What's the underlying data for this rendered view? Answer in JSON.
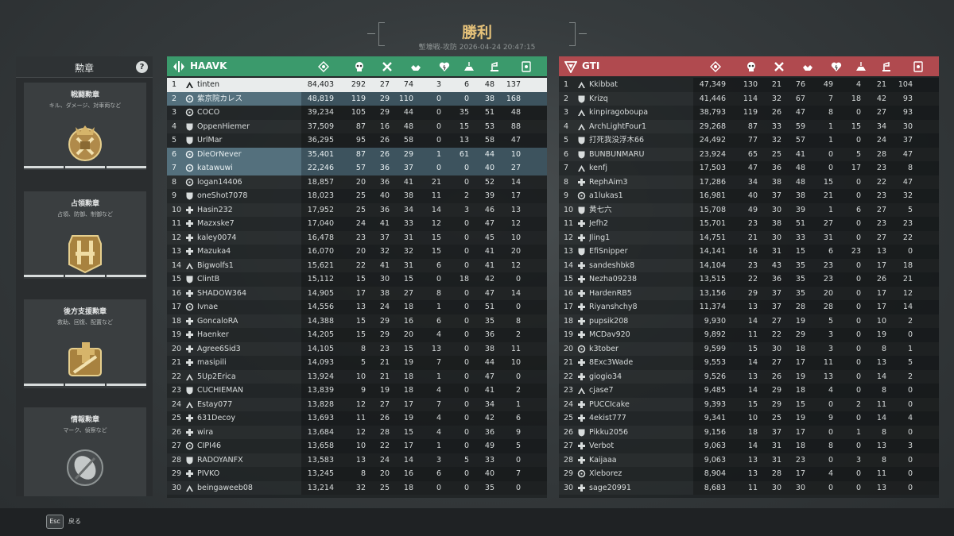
{
  "header": {
    "title": "勝利",
    "subtitle": "塹壕戦-攻防 2026-04-24 20:47:15"
  },
  "medals": {
    "title": "勲章",
    "help": "?",
    "cards": [
      {
        "name": "戦闘勲章",
        "desc": "キル、ダメージ、対車両など",
        "icon": "combat-medal"
      },
      {
        "name": "占領勲章",
        "desc": "占領、防御、制御など",
        "icon": "objective-medal"
      },
      {
        "name": "後方支援勲章",
        "desc": "救助、回復、配置など",
        "icon": "support-medal"
      },
      {
        "name": "情報勲章",
        "desc": "マーク、偵察など",
        "icon": "intel-medal"
      }
    ]
  },
  "footer": {
    "esc_key": "Esc",
    "back_label": "戻る"
  },
  "columns": [
    "score-icon",
    "kills-icon",
    "deaths-icon",
    "assists-icon",
    "revives-icon",
    "objective-icon",
    "support-icon",
    "intel-icon"
  ],
  "teams": [
    {
      "name": "HAAVK",
      "color": "#3b9a6c",
      "players": [
        {
          "rank": "1",
          "cls": "assault",
          "name": "tinten",
          "stats": [
            "84,403",
            "292",
            "27",
            "74",
            "3",
            "6",
            "48",
            "137"
          ],
          "highlight": "self"
        },
        {
          "rank": "2",
          "cls": "recon",
          "name": "紫京院カレス",
          "stats": [
            "48,819",
            "119",
            "29",
            "110",
            "0",
            "0",
            "38",
            "168"
          ],
          "highlight": "party"
        },
        {
          "rank": "3",
          "cls": "recon",
          "name": "COCO",
          "stats": [
            "39,234",
            "105",
            "29",
            "44",
            "0",
            "35",
            "51",
            "48"
          ]
        },
        {
          "rank": "4",
          "cls": "engineer",
          "name": "OppenHiemer",
          "stats": [
            "37,509",
            "87",
            "16",
            "48",
            "0",
            "15",
            "53",
            "88"
          ]
        },
        {
          "rank": "5",
          "cls": "engineer",
          "name": "UrlMar",
          "stats": [
            "36,295",
            "95",
            "26",
            "58",
            "0",
            "13",
            "58",
            "47"
          ]
        },
        {
          "rank": "6",
          "cls": "recon",
          "name": "DieOrNever",
          "stats": [
            "35,401",
            "87",
            "26",
            "29",
            "1",
            "61",
            "44",
            "10"
          ],
          "highlight": "party"
        },
        {
          "rank": "7",
          "cls": "recon",
          "name": "katawuwi",
          "stats": [
            "22,246",
            "57",
            "36",
            "37",
            "0",
            "0",
            "40",
            "27"
          ],
          "highlight": "party"
        },
        {
          "rank": "8",
          "cls": "recon",
          "name": "logan14406",
          "stats": [
            "18,857",
            "20",
            "36",
            "41",
            "21",
            "0",
            "52",
            "14"
          ]
        },
        {
          "rank": "9",
          "cls": "engineer",
          "name": "oneShot7078",
          "stats": [
            "18,023",
            "25",
            "40",
            "38",
            "11",
            "2",
            "39",
            "17"
          ]
        },
        {
          "rank": "10",
          "cls": "support",
          "name": "Hasin232",
          "stats": [
            "17,952",
            "25",
            "36",
            "34",
            "14",
            "3",
            "46",
            "13"
          ]
        },
        {
          "rank": "11",
          "cls": "support",
          "name": "Mazxske7",
          "stats": [
            "17,040",
            "24",
            "41",
            "33",
            "12",
            "0",
            "47",
            "12"
          ]
        },
        {
          "rank": "12",
          "cls": "support",
          "name": "kaley0074",
          "stats": [
            "16,478",
            "23",
            "37",
            "31",
            "15",
            "0",
            "45",
            "10"
          ]
        },
        {
          "rank": "13",
          "cls": "support",
          "name": "Mazuka4",
          "stats": [
            "16,070",
            "20",
            "32",
            "32",
            "15",
            "0",
            "41",
            "20"
          ]
        },
        {
          "rank": "14",
          "cls": "assault",
          "name": "Bigwolfs1",
          "stats": [
            "15,621",
            "22",
            "41",
            "31",
            "6",
            "0",
            "41",
            "12"
          ]
        },
        {
          "rank": "15",
          "cls": "engineer",
          "name": "ClintB",
          "stats": [
            "15,112",
            "15",
            "30",
            "15",
            "0",
            "18",
            "42",
            "0"
          ]
        },
        {
          "rank": "16",
          "cls": "support",
          "name": "SHADOW364",
          "stats": [
            "14,905",
            "17",
            "38",
            "27",
            "8",
            "0",
            "47",
            "14"
          ]
        },
        {
          "rank": "17",
          "cls": "recon",
          "name": "Ivnae",
          "stats": [
            "14,556",
            "13",
            "24",
            "18",
            "1",
            "0",
            "51",
            "0"
          ]
        },
        {
          "rank": "18",
          "cls": "support",
          "name": "GoncaloRA",
          "stats": [
            "14,388",
            "15",
            "29",
            "16",
            "6",
            "0",
            "35",
            "8"
          ]
        },
        {
          "rank": "19",
          "cls": "support",
          "name": "Haenker",
          "stats": [
            "14,205",
            "15",
            "29",
            "20",
            "4",
            "0",
            "36",
            "2"
          ]
        },
        {
          "rank": "20",
          "cls": "support",
          "name": "Agree6Sid3",
          "stats": [
            "14,105",
            "8",
            "23",
            "15",
            "13",
            "0",
            "38",
            "11"
          ]
        },
        {
          "rank": "21",
          "cls": "support",
          "name": "masipili",
          "stats": [
            "14,093",
            "5",
            "21",
            "19",
            "7",
            "0",
            "44",
            "10"
          ]
        },
        {
          "rank": "22",
          "cls": "assault",
          "name": "5Up2Erica",
          "stats": [
            "13,924",
            "10",
            "21",
            "18",
            "1",
            "0",
            "47",
            "0"
          ]
        },
        {
          "rank": "23",
          "cls": "engineer",
          "name": "CUCHIEMAN",
          "stats": [
            "13,839",
            "9",
            "19",
            "18",
            "4",
            "0",
            "41",
            "2"
          ]
        },
        {
          "rank": "24",
          "cls": "assault",
          "name": "Estay077",
          "stats": [
            "13,828",
            "12",
            "27",
            "17",
            "7",
            "0",
            "34",
            "1"
          ]
        },
        {
          "rank": "25",
          "cls": "support",
          "name": "631Decoy",
          "stats": [
            "13,693",
            "11",
            "26",
            "19",
            "4",
            "0",
            "42",
            "6"
          ]
        },
        {
          "rank": "26",
          "cls": "support",
          "name": "wira",
          "stats": [
            "13,684",
            "12",
            "28",
            "15",
            "4",
            "0",
            "36",
            "9"
          ]
        },
        {
          "rank": "27",
          "cls": "recon",
          "name": "CIPI46",
          "stats": [
            "13,658",
            "10",
            "22",
            "17",
            "1",
            "0",
            "49",
            "5"
          ]
        },
        {
          "rank": "28",
          "cls": "engineer",
          "name": "RADOYANFX",
          "stats": [
            "13,583",
            "13",
            "24",
            "14",
            "3",
            "5",
            "33",
            "0"
          ]
        },
        {
          "rank": "29",
          "cls": "support",
          "name": "PIVKO",
          "stats": [
            "13,245",
            "8",
            "20",
            "16",
            "6",
            "0",
            "40",
            "7"
          ]
        },
        {
          "rank": "30",
          "cls": "assault",
          "name": "beingaweeb08",
          "stats": [
            "13,214",
            "32",
            "25",
            "18",
            "0",
            "0",
            "35",
            "0"
          ]
        }
      ]
    },
    {
      "name": "GTI",
      "color": "#b04a4f",
      "players": [
        {
          "rank": "1",
          "cls": "assault",
          "name": "Kkibbat",
          "stats": [
            "47,349",
            "130",
            "21",
            "76",
            "49",
            "4",
            "21",
            "104"
          ]
        },
        {
          "rank": "2",
          "cls": "engineer",
          "name": "Krizq",
          "stats": [
            "41,446",
            "114",
            "32",
            "67",
            "7",
            "18",
            "42",
            "93"
          ]
        },
        {
          "rank": "3",
          "cls": "assault",
          "name": "kinpiragoboupa",
          "stats": [
            "38,793",
            "119",
            "26",
            "47",
            "8",
            "0",
            "27",
            "93"
          ]
        },
        {
          "rank": "4",
          "cls": "assault",
          "name": "ArchLightFour1",
          "stats": [
            "29,268",
            "87",
            "33",
            "59",
            "1",
            "15",
            "34",
            "30"
          ]
        },
        {
          "rank": "5",
          "cls": "engineer",
          "name": "打死我没浮木66",
          "stats": [
            "24,492",
            "77",
            "32",
            "57",
            "1",
            "0",
            "24",
            "37"
          ]
        },
        {
          "rank": "6",
          "cls": "engineer",
          "name": "BUNBUNMARU",
          "stats": [
            "23,924",
            "65",
            "25",
            "41",
            "0",
            "5",
            "28",
            "47"
          ]
        },
        {
          "rank": "7",
          "cls": "assault",
          "name": "kenfj",
          "stats": [
            "17,503",
            "47",
            "36",
            "48",
            "0",
            "17",
            "23",
            "8"
          ]
        },
        {
          "rank": "8",
          "cls": "support",
          "name": "RephAim3",
          "stats": [
            "17,286",
            "34",
            "38",
            "48",
            "15",
            "0",
            "22",
            "47"
          ]
        },
        {
          "rank": "9",
          "cls": "recon",
          "name": "a1lukas1",
          "stats": [
            "16,981",
            "40",
            "37",
            "38",
            "21",
            "0",
            "23",
            "32"
          ]
        },
        {
          "rank": "10",
          "cls": "engineer",
          "name": "黄七六",
          "stats": [
            "15,708",
            "49",
            "30",
            "39",
            "1",
            "6",
            "27",
            "5"
          ]
        },
        {
          "rank": "11",
          "cls": "support",
          "name": "Jefh2",
          "stats": [
            "15,701",
            "23",
            "38",
            "51",
            "27",
            "0",
            "23",
            "23"
          ]
        },
        {
          "rank": "12",
          "cls": "support",
          "name": "Jling1",
          "stats": [
            "14,751",
            "21",
            "30",
            "33",
            "31",
            "0",
            "27",
            "22"
          ]
        },
        {
          "rank": "13",
          "cls": "engineer",
          "name": "EfiSnipper",
          "stats": [
            "14,141",
            "16",
            "31",
            "15",
            "6",
            "23",
            "13",
            "0"
          ]
        },
        {
          "rank": "14",
          "cls": "support",
          "name": "sandeshbk8",
          "stats": [
            "14,104",
            "23",
            "43",
            "35",
            "23",
            "0",
            "17",
            "18"
          ]
        },
        {
          "rank": "15",
          "cls": "support",
          "name": "Nezha09238",
          "stats": [
            "13,515",
            "22",
            "36",
            "35",
            "23",
            "0",
            "26",
            "21"
          ]
        },
        {
          "rank": "16",
          "cls": "support",
          "name": "HardenRB5",
          "stats": [
            "13,156",
            "29",
            "37",
            "35",
            "20",
            "0",
            "17",
            "12"
          ]
        },
        {
          "rank": "17",
          "cls": "support",
          "name": "Riyanshchy8",
          "stats": [
            "11,374",
            "13",
            "37",
            "28",
            "28",
            "0",
            "17",
            "14"
          ]
        },
        {
          "rank": "18",
          "cls": "support",
          "name": "pupsik208",
          "stats": [
            "9,930",
            "14",
            "27",
            "19",
            "5",
            "0",
            "10",
            "2"
          ]
        },
        {
          "rank": "19",
          "cls": "support",
          "name": "MCDav920",
          "stats": [
            "9,892",
            "11",
            "22",
            "29",
            "3",
            "0",
            "19",
            "0"
          ]
        },
        {
          "rank": "20",
          "cls": "recon",
          "name": "k3tober",
          "stats": [
            "9,599",
            "15",
            "30",
            "18",
            "3",
            "0",
            "8",
            "1"
          ]
        },
        {
          "rank": "21",
          "cls": "support",
          "name": "8Exc3Wade",
          "stats": [
            "9,553",
            "14",
            "27",
            "17",
            "11",
            "0",
            "13",
            "5"
          ]
        },
        {
          "rank": "22",
          "cls": "support",
          "name": "giogio34",
          "stats": [
            "9,526",
            "13",
            "26",
            "19",
            "13",
            "0",
            "14",
            "2"
          ]
        },
        {
          "rank": "23",
          "cls": "assault",
          "name": "cjase7",
          "stats": [
            "9,485",
            "14",
            "29",
            "18",
            "4",
            "0",
            "8",
            "0"
          ]
        },
        {
          "rank": "24",
          "cls": "support",
          "name": "PUCCIcake",
          "stats": [
            "9,393",
            "15",
            "29",
            "15",
            "0",
            "2",
            "11",
            "0"
          ]
        },
        {
          "rank": "25",
          "cls": "support",
          "name": "4ekist777",
          "stats": [
            "9,341",
            "10",
            "25",
            "19",
            "9",
            "0",
            "14",
            "4"
          ]
        },
        {
          "rank": "26",
          "cls": "engineer",
          "name": "Pikku2056",
          "stats": [
            "9,156",
            "18",
            "37",
            "17",
            "0",
            "1",
            "8",
            "0"
          ]
        },
        {
          "rank": "27",
          "cls": "support",
          "name": "Verbot",
          "stats": [
            "9,063",
            "14",
            "31",
            "18",
            "8",
            "0",
            "13",
            "3"
          ]
        },
        {
          "rank": "28",
          "cls": "support",
          "name": "Kaijaaa",
          "stats": [
            "9,063",
            "13",
            "31",
            "23",
            "0",
            "3",
            "8",
            "0"
          ]
        },
        {
          "rank": "29",
          "cls": "recon",
          "name": "Xleborez",
          "stats": [
            "8,904",
            "13",
            "28",
            "17",
            "4",
            "0",
            "11",
            "0"
          ]
        },
        {
          "rank": "30",
          "cls": "support",
          "name": "sage20991",
          "stats": [
            "8,683",
            "11",
            "30",
            "30",
            "0",
            "0",
            "13",
            "0"
          ]
        }
      ]
    }
  ]
}
